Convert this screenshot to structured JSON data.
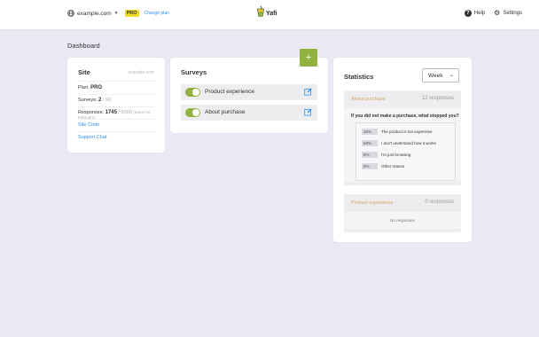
{
  "topbar": {
    "site": "example.com",
    "plan_badge": "PRO",
    "change_plan": "Change plan",
    "logo_text": "Yafi",
    "help": "Help",
    "settings": "Settings"
  },
  "page": {
    "title": "Dashboard"
  },
  "site_card": {
    "title": "Site",
    "domain": "example.com",
    "plan_label": "Plan:",
    "plan_value": "PRO",
    "surveys_label": "Surveys:",
    "surveys_value": "2",
    "surveys_limit": "/ 99",
    "responses_label": "Responses:",
    "responses_value": "1745",
    "responses_limit": "/ 5000",
    "responses_note": "(Since 01 February)",
    "site_code": "Site Code",
    "support_chat": "Support Chat"
  },
  "surveys_card": {
    "title": "Surveys",
    "add_label": "+",
    "items": [
      {
        "name": "Product experience",
        "enabled": true
      },
      {
        "name": "About purchase",
        "enabled": true
      }
    ]
  },
  "stats_card": {
    "title": "Statistics",
    "period": "Week",
    "blocks": [
      {
        "title": "About purchase",
        "count": "12 responses",
        "question": "If you did not make a purchase, what stopped you?",
        "answers": [
          {
            "pct": "25%",
            "label": "The product is too expensive"
          },
          {
            "pct": "58%",
            "label": "I don't understand how it works"
          },
          {
            "pct": "8%",
            "label": "I'm just browsing"
          },
          {
            "pct": "8%",
            "label": "Other reason"
          }
        ]
      },
      {
        "title": "Product experience",
        "count": "0 responses",
        "empty_text": "No responses"
      }
    ]
  },
  "colors": {
    "background": "#ebe8f3",
    "accent_green": "#8fb33e",
    "link_blue": "#2f8ff0",
    "pro_yellow": "#f3dc28",
    "stat_title": "#d2a56a"
  }
}
